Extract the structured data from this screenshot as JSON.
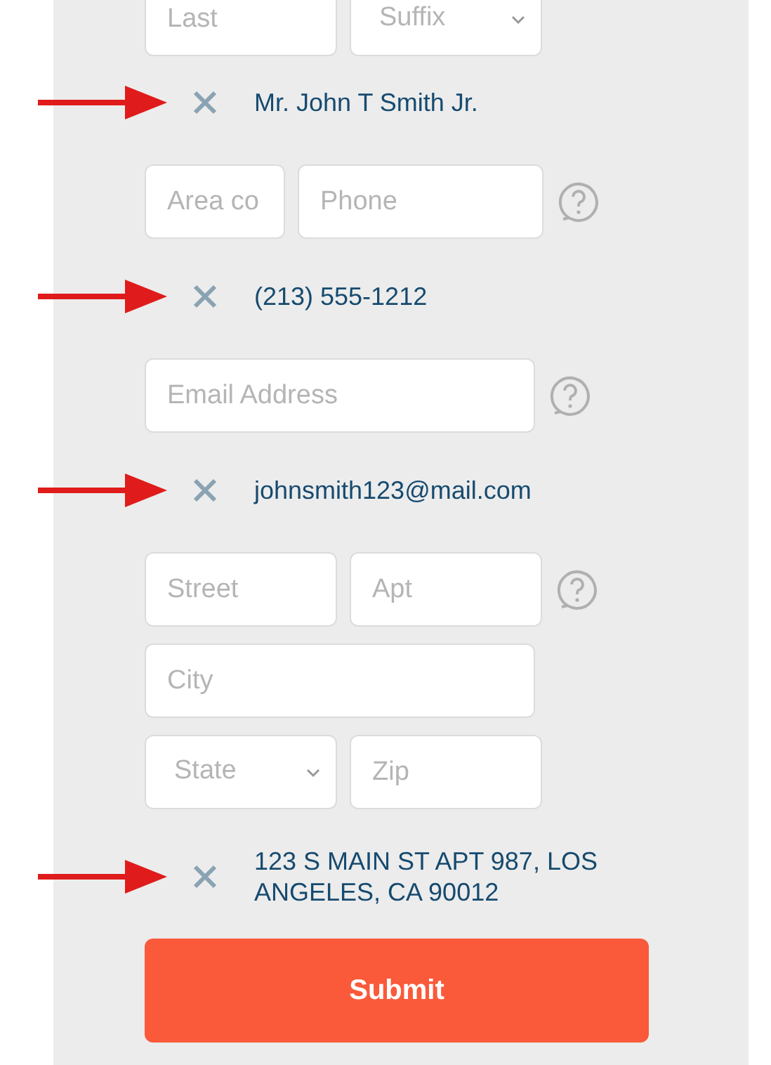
{
  "groups": [
    {
      "rows": [
        [
          {
            "kind": "input",
            "placeholder": "Last"
          },
          {
            "kind": "select",
            "placeholder": "Suffix"
          }
        ]
      ],
      "help": false,
      "result": {
        "text": "Mr. John T Smith Jr.",
        "arrow": true
      }
    },
    {
      "rows": [
        [
          {
            "kind": "input",
            "placeholder": "Area co"
          },
          {
            "kind": "input",
            "placeholder": "Phone"
          }
        ]
      ],
      "help": true,
      "result": {
        "text": "(213) 555-1212",
        "arrow": true
      }
    },
    {
      "rows": [
        [
          {
            "kind": "input",
            "placeholder": "Email Address"
          }
        ]
      ],
      "help": true,
      "result": {
        "text": "johnsmith123@mail.com",
        "arrow": true
      }
    },
    {
      "rows": [
        [
          {
            "kind": "input",
            "placeholder": "Street"
          },
          {
            "kind": "input",
            "placeholder": "Apt"
          }
        ],
        [
          {
            "kind": "input",
            "placeholder": "City"
          }
        ],
        [
          {
            "kind": "select",
            "placeholder": "State"
          },
          {
            "kind": "input",
            "placeholder": "Zip"
          }
        ]
      ],
      "help": true,
      "result": {
        "text": "123 S MAIN ST APT 987, LOS ANGELES, CA 90012",
        "arrow": true
      }
    }
  ],
  "submit": "Submit"
}
